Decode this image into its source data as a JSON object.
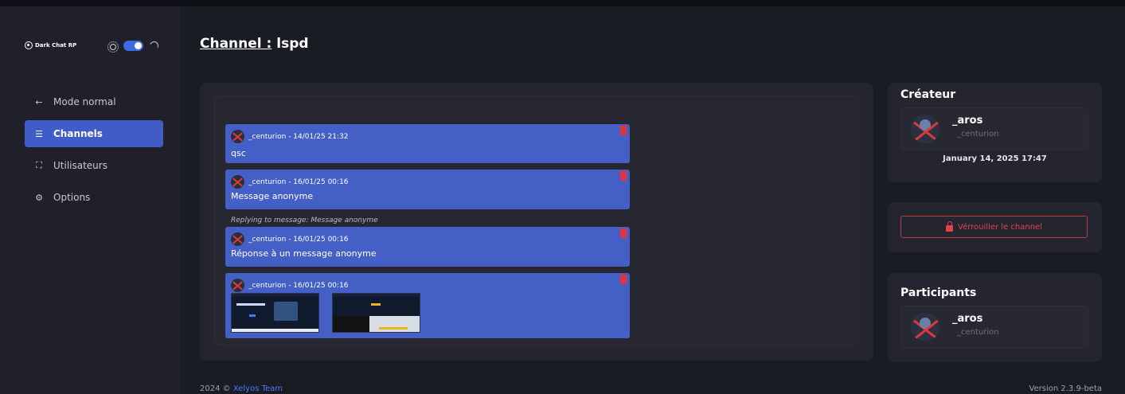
{
  "brand": {
    "name": "Dark Chat RP"
  },
  "theme_toggle": {
    "state": "dark"
  },
  "nav": {
    "items": [
      {
        "label": "Mode normal",
        "icon": "arrow-left-icon",
        "active": false
      },
      {
        "label": "Channels",
        "icon": "server-icon",
        "active": true
      },
      {
        "label": "Utilisateurs",
        "icon": "users-scan-icon",
        "active": false
      },
      {
        "label": "Options",
        "icon": "gear-icon",
        "active": false
      }
    ]
  },
  "page": {
    "title_prefix": "Channel :",
    "channel_name": "lspd"
  },
  "messages": [
    {
      "author_line": "_centurion - 14/01/25 21:32",
      "text": "qsc"
    },
    {
      "author_line": "_centurion - 16/01/25 00:16",
      "text": "Message anonyme"
    },
    {
      "author_line": "_centurion - 16/01/25 00:16",
      "text": "Réponse à un message anonyme"
    },
    {
      "author_line": "_centurion - 16/01/25 00:16",
      "text": ""
    }
  ],
  "reply_note": "Replying to message: Message anonyme",
  "creator": {
    "title": "Créateur",
    "name": "_aros",
    "handle": "_centurion",
    "created_at": "January 14, 2025 17:47"
  },
  "lock": {
    "label": "Vérrouiller le channel"
  },
  "participants": {
    "title": "Participants",
    "items": [
      {
        "name": "_aros",
        "handle": "_centurion"
      }
    ]
  },
  "footer": {
    "copyright": "2024 ©",
    "team": "Xelyos Team",
    "version": "Version 2.3.9-beta"
  },
  "colors": {
    "accent": "#4460c6",
    "danger": "#e0343f",
    "background": "#1a1c24"
  }
}
